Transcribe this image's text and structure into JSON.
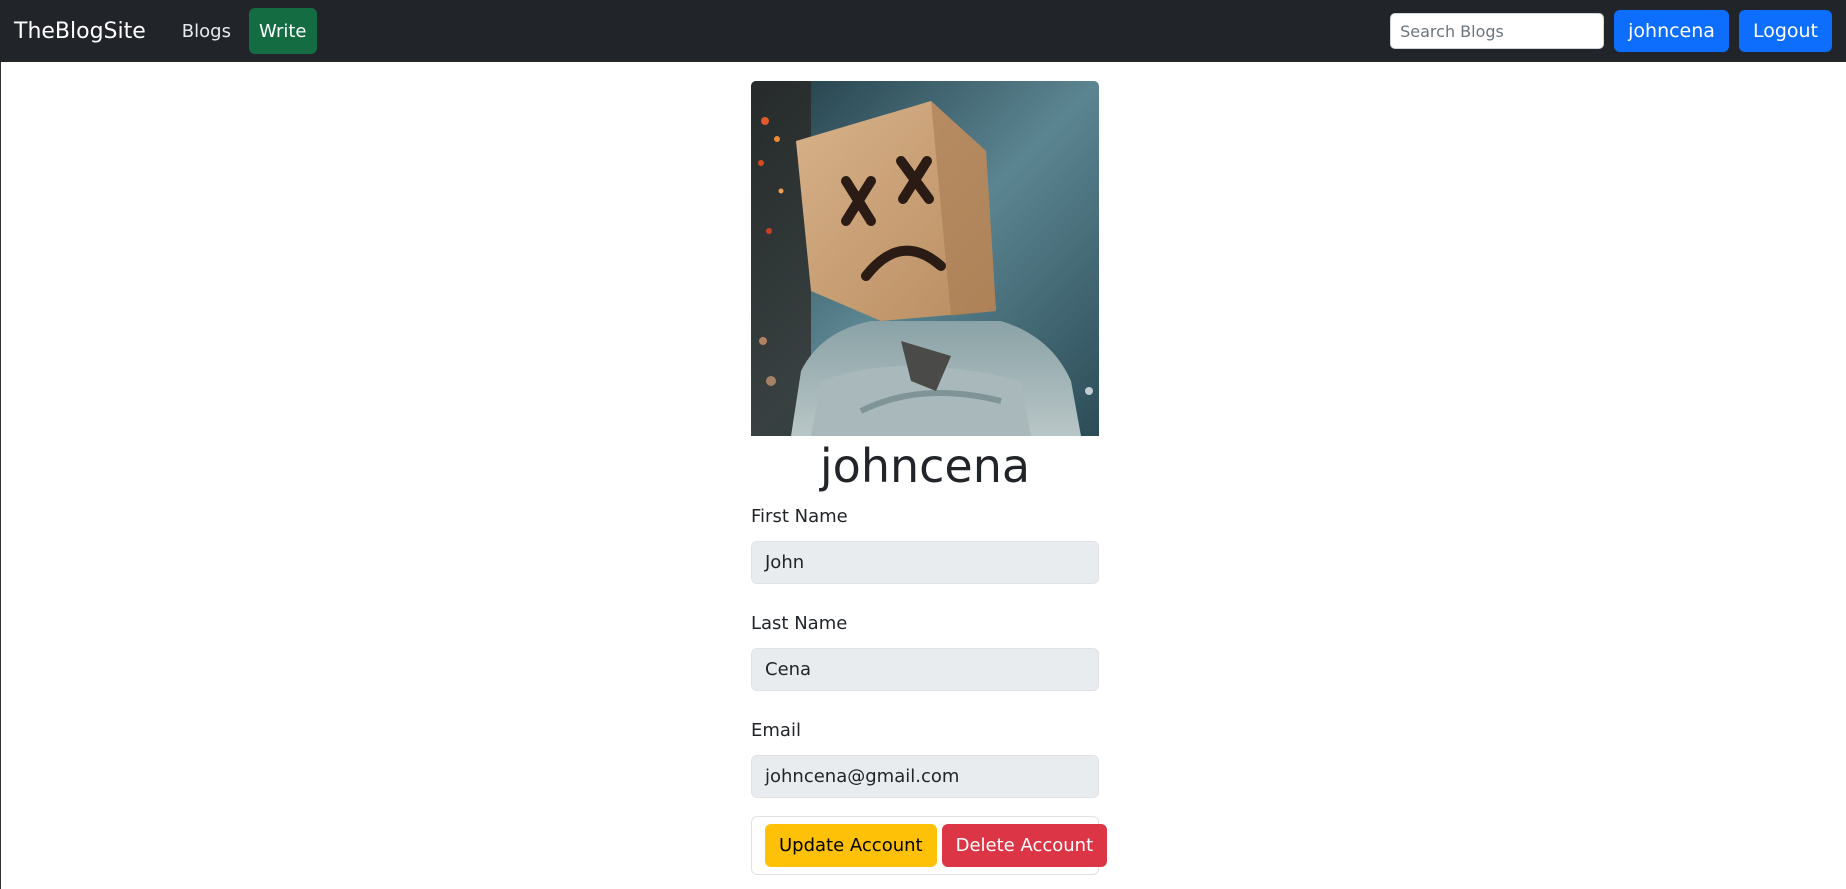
{
  "navbar": {
    "brand": "TheBlogSite",
    "links": [
      {
        "label": "Blogs"
      },
      {
        "label": "Write"
      }
    ],
    "search": {
      "placeholder": "Search Blogs",
      "value": ""
    },
    "user_button": "johncena",
    "logout_button": "Logout"
  },
  "profile": {
    "username": "johncena",
    "fields": [
      {
        "label": "First Name",
        "value": "John"
      },
      {
        "label": "Last Name",
        "value": "Cena"
      },
      {
        "label": "Email",
        "value": "johncena@gmail.com"
      }
    ],
    "update_button": "Update Account",
    "delete_button": "Delete Account"
  },
  "colors": {
    "navbar_bg": "#212529",
    "write_green": "#146c43",
    "primary_blue": "#0d6efd",
    "warning_yellow": "#ffc107",
    "danger_red": "#dc3545",
    "field_bg": "#e9ecef"
  }
}
